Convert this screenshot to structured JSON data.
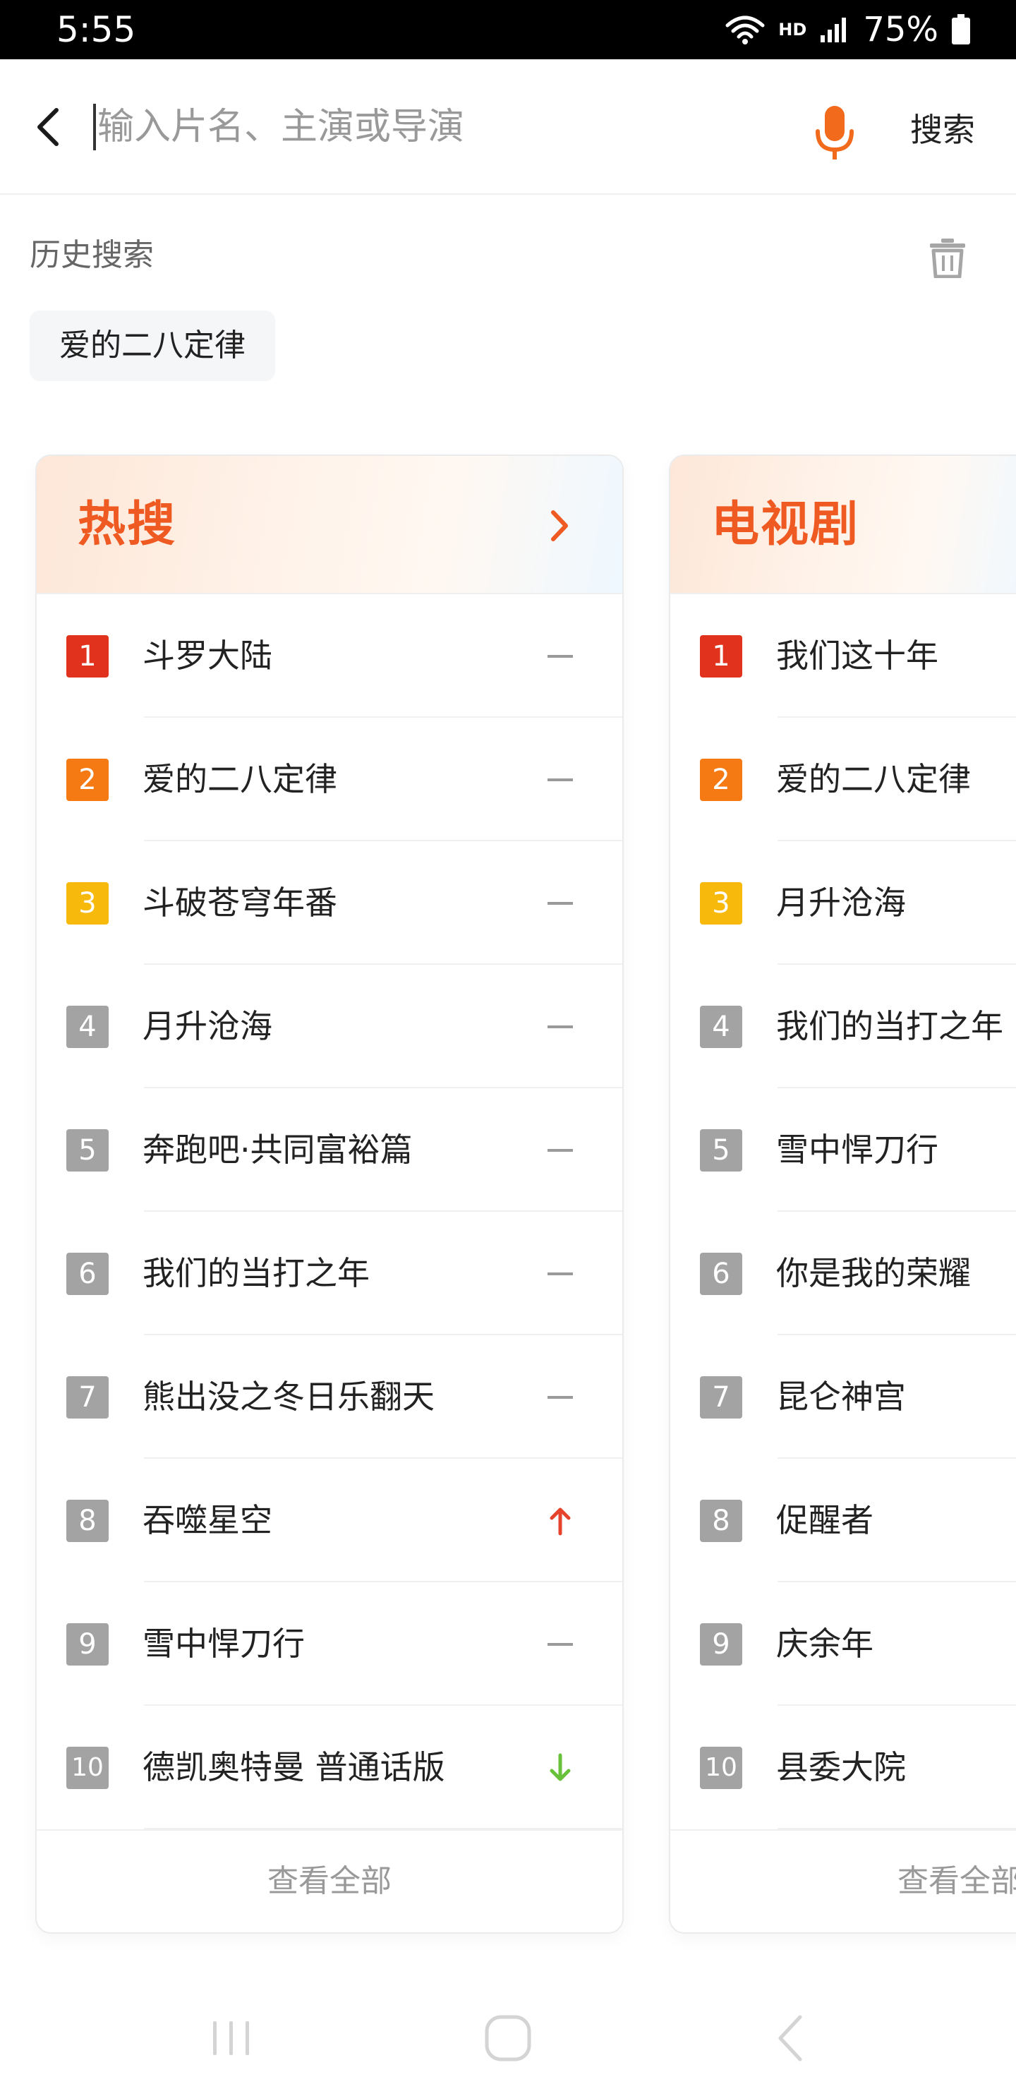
{
  "status_bar": {
    "time": "5:55",
    "hd": "HD",
    "battery": "75%"
  },
  "search": {
    "placeholder": "输入片名、主演或导演",
    "value": "",
    "submit_label": "搜索",
    "accent_color": "#f26b1d"
  },
  "history": {
    "title": "历史搜索",
    "items": [
      "爱的二八定律"
    ]
  },
  "hot_card": {
    "title": "热搜",
    "view_all": "查看全部",
    "items": [
      {
        "rank": "1",
        "title": "斗罗大陆",
        "trend": "flat"
      },
      {
        "rank": "2",
        "title": "爱的二八定律",
        "trend": "flat"
      },
      {
        "rank": "3",
        "title": "斗破苍穹年番",
        "trend": "flat"
      },
      {
        "rank": "4",
        "title": "月升沧海",
        "trend": "flat"
      },
      {
        "rank": "5",
        "title": "奔跑吧·共同富裕篇",
        "trend": "flat"
      },
      {
        "rank": "6",
        "title": "我们的当打之年",
        "trend": "flat"
      },
      {
        "rank": "7",
        "title": "熊出没之冬日乐翻天",
        "trend": "flat"
      },
      {
        "rank": "8",
        "title": "吞噬星空",
        "trend": "up"
      },
      {
        "rank": "9",
        "title": "雪中悍刀行",
        "trend": "flat"
      },
      {
        "rank": "10",
        "title": "德凯奥特曼 普通话版",
        "trend": "down"
      }
    ]
  },
  "tv_card": {
    "title": "电视剧",
    "view_all": "查看全部",
    "items": [
      {
        "rank": "1",
        "title": "我们这十年"
      },
      {
        "rank": "2",
        "title": "爱的二八定律"
      },
      {
        "rank": "3",
        "title": "月升沧海"
      },
      {
        "rank": "4",
        "title": "我们的当打之年"
      },
      {
        "rank": "5",
        "title": "雪中悍刀行"
      },
      {
        "rank": "6",
        "title": "你是我的荣耀"
      },
      {
        "rank": "7",
        "title": "昆仑神宫"
      },
      {
        "rank": "8",
        "title": "促醒者"
      },
      {
        "rank": "9",
        "title": "庆余年"
      },
      {
        "rank": "10",
        "title": "县委大院"
      }
    ]
  },
  "rank_colors": {
    "1": "#e0321c",
    "2": "#f57a14",
    "3": "#f8b90d",
    "default": "#a3a3a3"
  },
  "trend_colors": {
    "up": "#e5432b",
    "down": "#67c23a",
    "flat": "#9a9a9a"
  },
  "nav_bar": {
    "icons": [
      "recent-apps-icon",
      "home-icon",
      "back-icon"
    ]
  }
}
